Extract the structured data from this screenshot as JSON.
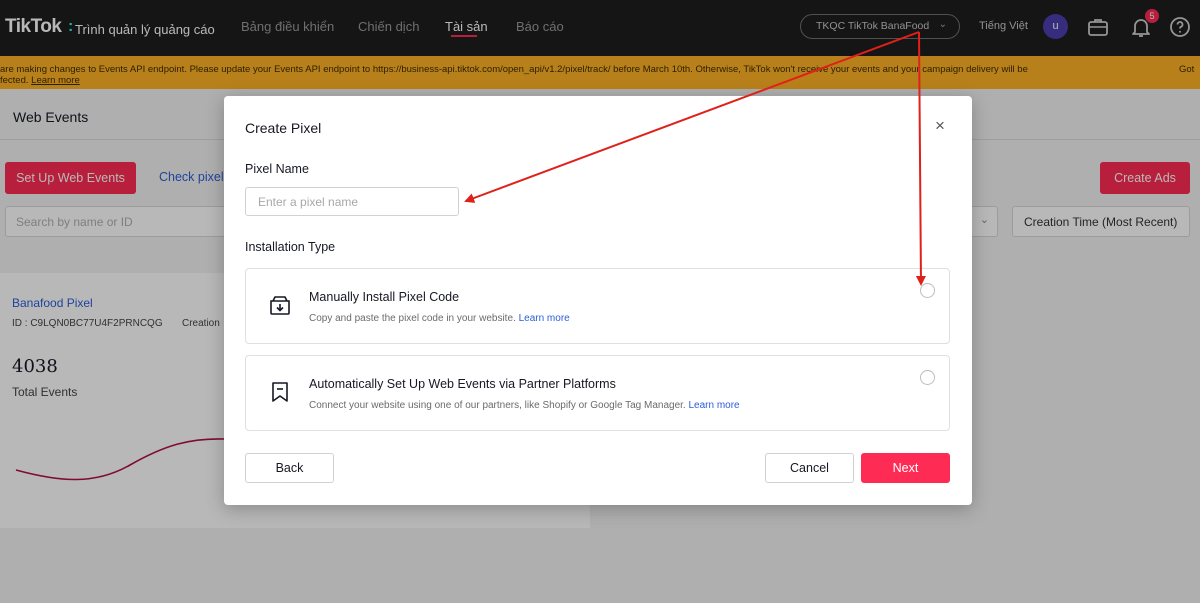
{
  "topnav": {
    "brand": "TikTok",
    "brand_sub": "Trình quản lý quảng cáo",
    "links": [
      "Bảng điều khiển",
      "Chiến dịch",
      "Tài sản",
      "Báo cáo"
    ],
    "account": "TKQC TikTok BanaFood",
    "language": "Tiếng Việt",
    "avatar_letter": "u",
    "notification_count": "5",
    "icons": [
      "briefcase-icon",
      "bell-icon",
      "help-icon"
    ]
  },
  "banner": {
    "text_line1": "are making changes to Events API endpoint. Please update your Events API endpoint to https://business-api.tiktok.com/open_api/v1.2/pixel/track/ before March 10th. Otherwise, TikTok won't receive your events and your campaign delivery will be",
    "text_line2_prefix": "fected. ",
    "learn_more": "Learn more",
    "right": "Got"
  },
  "page": {
    "title": "Web Events",
    "setup_button": "Set Up Web Events",
    "check_pixel": "Check pixel",
    "create_ads": "Create Ads",
    "search_placeholder": "Search by name or ID",
    "sort": "Creation Time (Most Recent)",
    "pixel": {
      "name": "Banafood Pixel",
      "id": "ID : C9LQN0BC77U4F2PRNCQG",
      "created": "Creation",
      "total": "4038",
      "total_label": "Total Events"
    }
  },
  "modal": {
    "title": "Create Pixel",
    "pixel_name_label": "Pixel Name",
    "pixel_name_placeholder": "Enter a pixel name",
    "pixel_name_value": "",
    "installation_label": "Installation Type",
    "options": [
      {
        "title": "Manually Install Pixel Code",
        "desc": "Copy and paste the pixel code in your website. ",
        "link": "Learn more",
        "icon": "download-box-icon",
        "selected": false
      },
      {
        "title": "Automatically Set Up Web Events via Partner Platforms",
        "desc": "Connect your website using one of our partners, like Shopify or Google Tag Manager. ",
        "link": "Learn more",
        "icon": "bookmark-icon",
        "selected": false
      }
    ],
    "back": "Back",
    "cancel": "Cancel",
    "next": "Next"
  },
  "colors": {
    "brand_red": "#fe2c55",
    "banner": "#ffb224",
    "annotation_arrow": "#e0201a",
    "link": "#2b5dd8"
  }
}
